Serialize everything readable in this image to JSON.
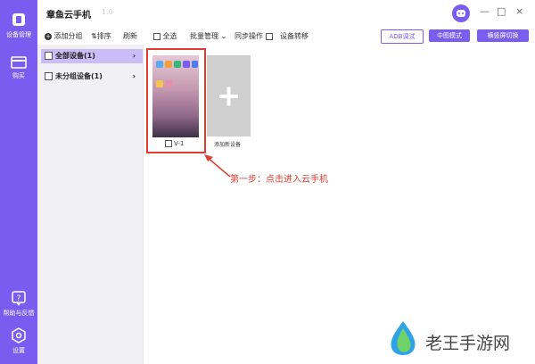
{
  "app": {
    "title": "章鱼云手机",
    "title_sub": "1.0"
  },
  "window_controls": {
    "minimize": "—",
    "maximize": "□",
    "close": "×"
  },
  "sidebar": {
    "items": [
      {
        "label": "设备管理",
        "icon": "phone-icon"
      },
      {
        "label": "购买",
        "icon": "card-icon"
      },
      {
        "label": "帮助与反馈",
        "icon": "help-icon"
      },
      {
        "label": "设置",
        "icon": "gear-icon"
      }
    ]
  },
  "left_toolbar": {
    "add_group": "添加分组",
    "sort": "排序",
    "refresh": "刷新"
  },
  "groups": [
    {
      "label": "全部设备(1)",
      "active": true
    },
    {
      "label": "未分组设备(1)",
      "active": false
    }
  ],
  "main_toolbar": {
    "select_all": "全选",
    "batch_manage": "批量管理",
    "sync_ops": "同步操作",
    "device_transfer": "设备转移",
    "adb_debug": "ADB调试",
    "medium_mode": "中图模式",
    "orientation_toggle": "横竖屏切换"
  },
  "devices": [
    {
      "name": "V-1"
    }
  ],
  "add_device": {
    "label": "添加新设备",
    "symbol": "+"
  },
  "annotation": {
    "text": "第一步：点击进入云手机"
  },
  "watermark": {
    "text": "老王手游网"
  },
  "colors": {
    "accent": "#7b5cf0",
    "highlight": "#e03d30",
    "active_group": "#c9bcf7"
  }
}
